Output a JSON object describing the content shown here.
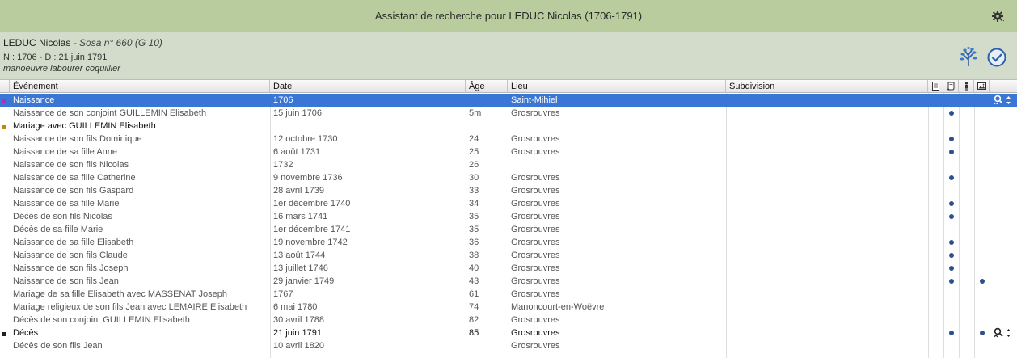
{
  "window": {
    "title": "Assistant de recherche pour LEDUC Nicolas (1706-1791)",
    "gear_icon": "gear-icon"
  },
  "person": {
    "name": "LEDUC Nicolas",
    "sosa": " - Sosa n° 660 (G 10)",
    "dates": "N : 1706 - D : 21 juin 1791",
    "occupation": "manoeuvre labourer coquillier",
    "icons": [
      "family-tree-icon",
      "checkmark-icon"
    ]
  },
  "columns": {
    "event": "Événement",
    "date": "Date",
    "age": "Âge",
    "place": "Lieu",
    "subdivision": "Subdivision",
    "icon_cols": [
      "note-icon",
      "source-icon",
      "person-icon",
      "media-icon"
    ]
  },
  "colors": {
    "titlebar": "#b9cc9e",
    "infobar": "#d3dccb",
    "selection": "#3a76d6",
    "dot": "#2f4f8c",
    "marker_birth": "#b02fb8",
    "marker_marriage": "#c58a00",
    "marker_death": "#222222"
  },
  "rows": [
    {
      "event": "Naissance",
      "date": "1706",
      "age": "",
      "place": "Saint-Mihiel",
      "subdivision": "",
      "principal": true,
      "selected": true,
      "marker": "marker_birth",
      "dot1": false,
      "dot2": false,
      "tool": true
    },
    {
      "event": "Naissance de son conjoint GUILLEMIN Elisabeth",
      "date": "15 juin 1706",
      "age": "5m",
      "place": "Grosrouvres",
      "subdivision": "",
      "principal": false,
      "selected": false,
      "marker": "",
      "dot1": true,
      "dot2": false,
      "tool": false
    },
    {
      "event": "Mariage avec GUILLEMIN Elisabeth",
      "date": "",
      "age": "",
      "place": "",
      "subdivision": "",
      "principal": true,
      "selected": false,
      "marker": "marker_marriage",
      "dot1": false,
      "dot2": false,
      "tool": false
    },
    {
      "event": "Naissance de son fils Dominique",
      "date": "12 octobre 1730",
      "age": "24",
      "place": "Grosrouvres",
      "subdivision": "",
      "principal": false,
      "selected": false,
      "marker": "",
      "dot1": true,
      "dot2": false,
      "tool": false
    },
    {
      "event": "Naissance de sa fille Anne",
      "date": "6 août 1731",
      "age": "25",
      "place": "Grosrouvres",
      "subdivision": "",
      "principal": false,
      "selected": false,
      "marker": "",
      "dot1": true,
      "dot2": false,
      "tool": false
    },
    {
      "event": "Naissance de son fils Nicolas",
      "date": "1732",
      "age": "26",
      "place": "",
      "subdivision": "",
      "principal": false,
      "selected": false,
      "marker": "",
      "dot1": false,
      "dot2": false,
      "tool": false
    },
    {
      "event": "Naissance de sa fille Catherine",
      "date": "9 novembre 1736",
      "age": "30",
      "place": "Grosrouvres",
      "subdivision": "",
      "principal": false,
      "selected": false,
      "marker": "",
      "dot1": true,
      "dot2": false,
      "tool": false
    },
    {
      "event": "Naissance de son fils Gaspard",
      "date": "28 avril 1739",
      "age": "33",
      "place": "Grosrouvres",
      "subdivision": "",
      "principal": false,
      "selected": false,
      "marker": "",
      "dot1": false,
      "dot2": false,
      "tool": false
    },
    {
      "event": "Naissance de sa fille Marie",
      "date": "1er décembre 1740",
      "age": "34",
      "place": "Grosrouvres",
      "subdivision": "",
      "principal": false,
      "selected": false,
      "marker": "",
      "dot1": true,
      "dot2": false,
      "tool": false
    },
    {
      "event": "Décès de son fils Nicolas",
      "date": "16 mars 1741",
      "age": "35",
      "place": "Grosrouvres",
      "subdivision": "",
      "principal": false,
      "selected": false,
      "marker": "",
      "dot1": true,
      "dot2": false,
      "tool": false
    },
    {
      "event": "Décès de sa fille Marie",
      "date": "1er décembre 1741",
      "age": "35",
      "place": "Grosrouvres",
      "subdivision": "",
      "principal": false,
      "selected": false,
      "marker": "",
      "dot1": false,
      "dot2": false,
      "tool": false
    },
    {
      "event": "Naissance de sa fille Elisabeth",
      "date": "19 novembre 1742",
      "age": "36",
      "place": "Grosrouvres",
      "subdivision": "",
      "principal": false,
      "selected": false,
      "marker": "",
      "dot1": true,
      "dot2": false,
      "tool": false
    },
    {
      "event": "Naissance de son fils Claude",
      "date": "13 août 1744",
      "age": "38",
      "place": "Grosrouvres",
      "subdivision": "",
      "principal": false,
      "selected": false,
      "marker": "",
      "dot1": true,
      "dot2": false,
      "tool": false
    },
    {
      "event": "Naissance de son fils Joseph",
      "date": "13 juillet 1746",
      "age": "40",
      "place": "Grosrouvres",
      "subdivision": "",
      "principal": false,
      "selected": false,
      "marker": "",
      "dot1": true,
      "dot2": false,
      "tool": false
    },
    {
      "event": "Naissance de son fils Jean",
      "date": "29 janvier 1749",
      "age": "43",
      "place": "Grosrouvres",
      "subdivision": "",
      "principal": false,
      "selected": false,
      "marker": "",
      "dot1": true,
      "dot2": true,
      "tool": false
    },
    {
      "event": "Mariage de sa fille Elisabeth avec MASSENAT Joseph",
      "date": "1767",
      "age": "61",
      "place": "Grosrouvres",
      "subdivision": "",
      "principal": false,
      "selected": false,
      "marker": "",
      "dot1": false,
      "dot2": false,
      "tool": false
    },
    {
      "event": "Mariage religieux de son fils Jean avec LEMAIRE Elisabeth",
      "date": "6 mai 1780",
      "age": "74",
      "place": "Manoncourt-en-Woëvre",
      "subdivision": "",
      "principal": false,
      "selected": false,
      "marker": "",
      "dot1": false,
      "dot2": false,
      "tool": false
    },
    {
      "event": "Décès de son conjoint GUILLEMIN Elisabeth",
      "date": "30 avril 1788",
      "age": "82",
      "place": "Grosrouvres",
      "subdivision": "",
      "principal": false,
      "selected": false,
      "marker": "",
      "dot1": false,
      "dot2": false,
      "tool": false
    },
    {
      "event": "Décès",
      "date": "21 juin 1791",
      "age": "85",
      "place": "Grosrouvres",
      "subdivision": "",
      "principal": true,
      "selected": false,
      "marker": "marker_death",
      "dot1": true,
      "dot2": true,
      "tool": true
    },
    {
      "event": "Décès de son fils Jean",
      "date": "10 avril 1820",
      "age": "",
      "place": "Grosrouvres",
      "subdivision": "",
      "principal": false,
      "selected": false,
      "marker": "",
      "dot1": false,
      "dot2": false,
      "tool": false
    }
  ]
}
